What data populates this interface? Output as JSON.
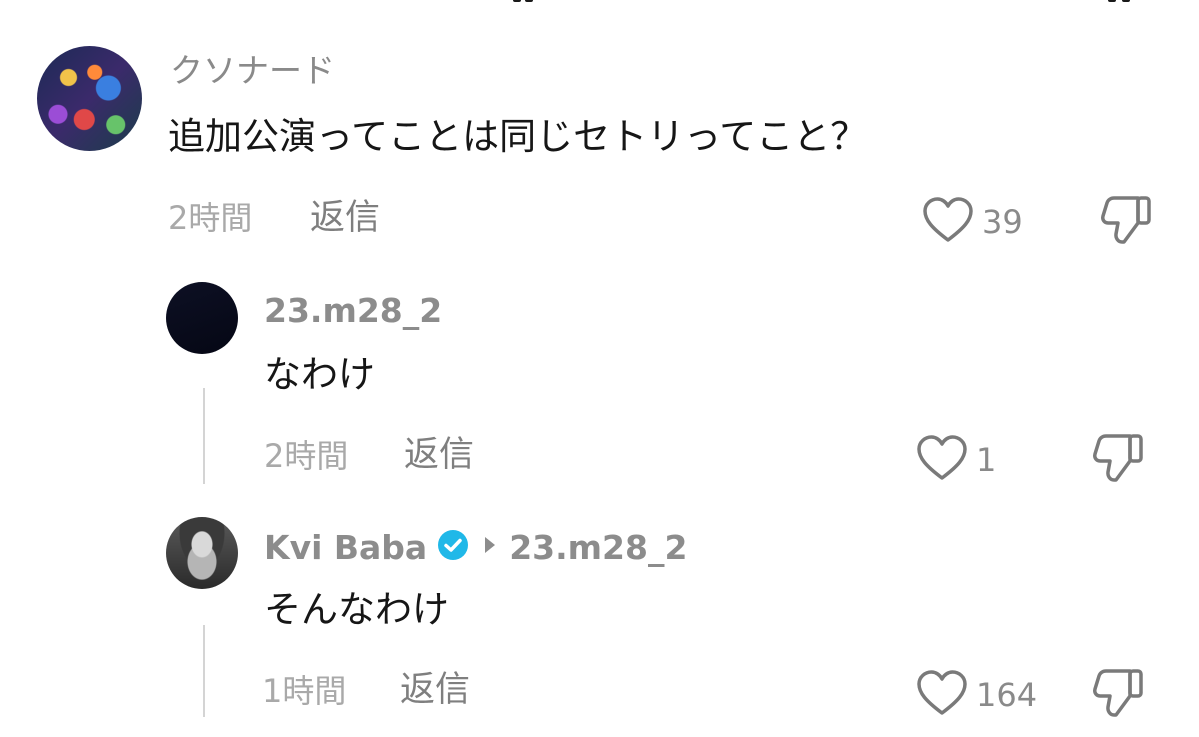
{
  "comments": [
    {
      "username": "クソナード",
      "text": "追加公演ってことは同じセトリってこと？",
      "time": "2時間",
      "reply_label": "返信",
      "likes": "39"
    },
    {
      "username": "23.m28_2",
      "text": "なわけ",
      "time": "2時間",
      "reply_label": "返信",
      "likes": "1"
    },
    {
      "username": "Kvi Baba",
      "reply_to": "23.m28_2",
      "verified": true,
      "text": "そんなわけ",
      "time": "1時間",
      "reply_label": "返信",
      "likes": "164"
    }
  ],
  "icons": {
    "like": "heart-outline-icon",
    "dislike": "thumbs-down-outline-icon",
    "verified": "verified-badge-icon",
    "reply_arrow": "triangle-right-icon"
  },
  "colors": {
    "verified_badge": "#20b8e8",
    "meta_text": "#a9a9a9",
    "username": "#8a8a8a",
    "body_text": "#161616",
    "icon_stroke": "#7a7a7a"
  }
}
